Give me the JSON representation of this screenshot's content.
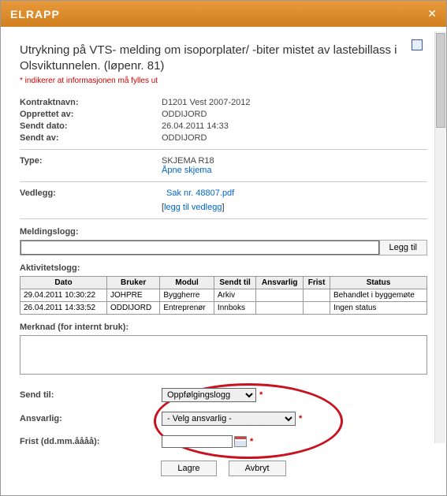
{
  "titlebar": {
    "title": "ELRAPP"
  },
  "heading": "Utrykning på VTS- melding om isoporplater/ -biter mistet av lastebillass i Olsviktunnelen. (løpenr. 81)",
  "required_note": "* indikerer at informasjonen må fylles ut",
  "info": {
    "kontraktnavn_label": "Kontraktnavn:",
    "kontraktnavn_value": "D1201 Vest 2007-2012",
    "opprettet_av_label": "Opprettet av:",
    "opprettet_av_value": "ODDIJORD",
    "sendt_dato_label": "Sendt dato:",
    "sendt_dato_value": "26.04.2011 14:33",
    "sendt_av_label": "Sendt av:",
    "sendt_av_value": "ODDIJORD",
    "type_label": "Type:",
    "type_value": "SKJEMA R18",
    "apne_skjema": "Åpne skjema",
    "vedlegg_label": "Vedlegg:",
    "vedlegg_file": "Sak nr. 48807.pdf",
    "legg_til_vedlegg": "legg til vedlegg"
  },
  "meldingslogg": {
    "label": "Meldingslogg:",
    "button": "Legg til"
  },
  "aktivitet": {
    "label": "Aktivitetslogg:",
    "headers": {
      "dato": "Dato",
      "bruker": "Bruker",
      "modul": "Modul",
      "sendt_til": "Sendt til",
      "ansvarlig": "Ansvarlig",
      "frist": "Frist",
      "status": "Status"
    },
    "rows": [
      {
        "dato": "29.04.2011 10:30:22",
        "bruker": "JOHPRE",
        "modul": "Byggherre",
        "sendt_til": "Arkiv",
        "ansvarlig": "",
        "frist": "",
        "status": "Behandlet i byggemøte"
      },
      {
        "dato": "26.04.2011 14:33:52",
        "bruker": "ODDIJORD",
        "modul": "Entreprenør",
        "sendt_til": "Innboks",
        "ansvarlig": "",
        "frist": "",
        "status": "Ingen status"
      }
    ]
  },
  "merknad_label": "Merknad (for internt bruk):",
  "form": {
    "send_til_label": "Send til:",
    "send_til_value": "Oppfølgingslogg",
    "ansvarlig_label": "Ansvarlig:",
    "ansvarlig_value": "- Velg ansvarlig -",
    "frist_label": "Frist (dd.mm.åååå):"
  },
  "buttons": {
    "lagre": "Lagre",
    "avbryt": "Avbryt"
  }
}
